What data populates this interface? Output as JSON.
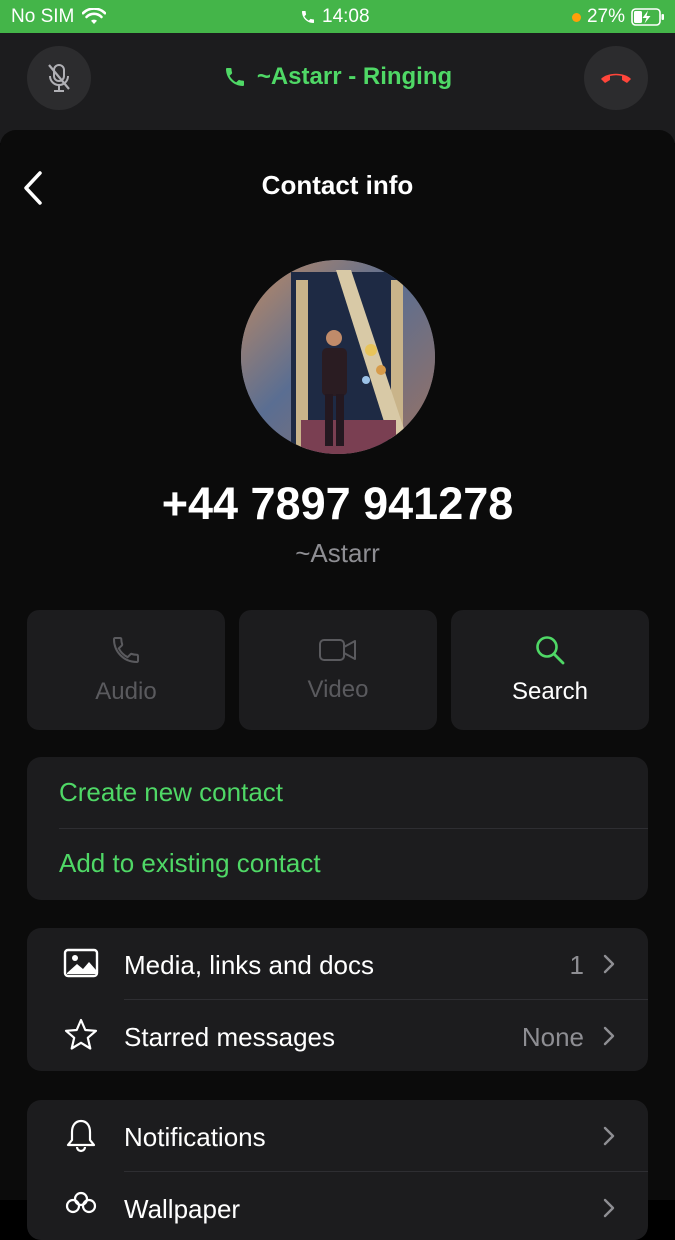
{
  "status_bar": {
    "carrier": "No SIM",
    "time": "14:08",
    "battery": "27%"
  },
  "call": {
    "status_text": "~Astarr - Ringing"
  },
  "header": {
    "title": "Contact info"
  },
  "contact": {
    "phone": "+44 7897 941278",
    "username": "~Astarr"
  },
  "actions": [
    {
      "label": "Audio",
      "icon": "phone-icon",
      "enabled": false
    },
    {
      "label": "Video",
      "icon": "video-icon",
      "enabled": false
    },
    {
      "label": "Search",
      "icon": "search-icon",
      "enabled": true
    }
  ],
  "contact_options": {
    "create": "Create new contact",
    "add_existing": "Add to existing contact"
  },
  "media_section": [
    {
      "label": "Media, links and docs",
      "value": "1",
      "icon": "image-icon"
    },
    {
      "label": "Starred messages",
      "value": "None",
      "icon": "star-icon"
    }
  ],
  "settings_section": [
    {
      "label": "Notifications",
      "icon": "bell-icon"
    },
    {
      "label": "Wallpaper",
      "icon": "flower-icon"
    }
  ],
  "colors": {
    "accent": "#4fd866",
    "status_bar": "#44b549",
    "end_call": "#ff453a"
  }
}
